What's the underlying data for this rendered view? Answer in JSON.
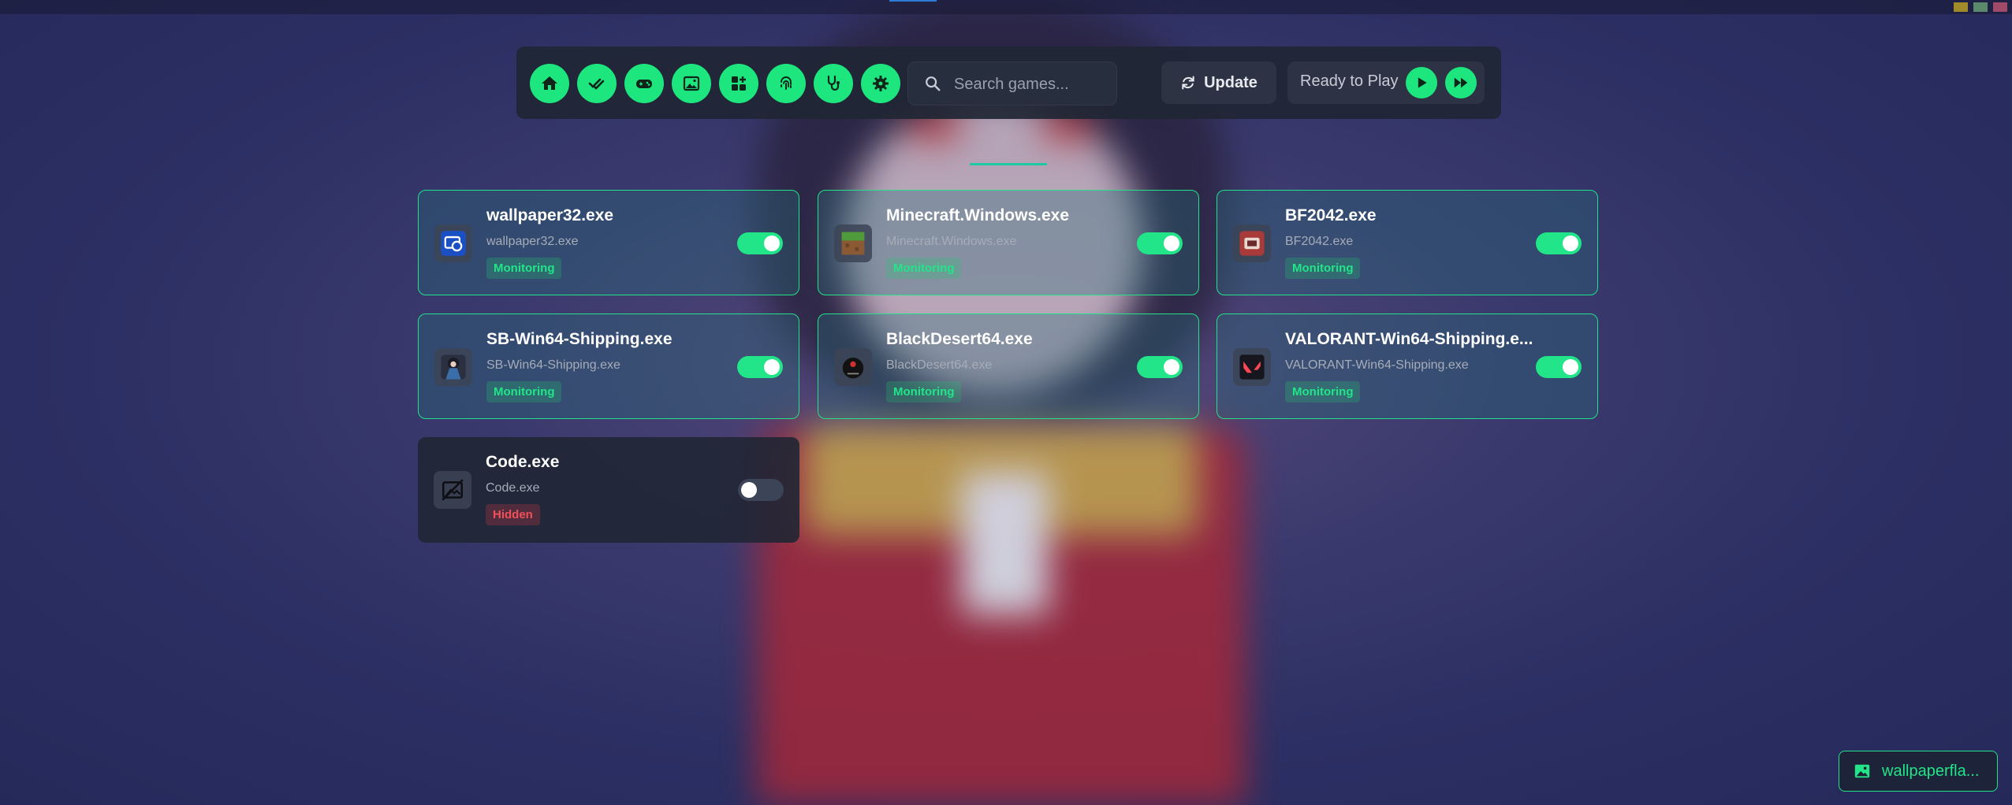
{
  "toolbar": {
    "nav_icons": [
      "home-icon",
      "checks-icon",
      "gamepad-icon",
      "image-icon",
      "apps-icon",
      "fingerprint-icon",
      "stethoscope-icon",
      "gear-icon"
    ],
    "search_placeholder": "Search games...",
    "update_label": "Update",
    "ready_label": "Ready to Play"
  },
  "colors": {
    "accent": "#1ee67f",
    "hidden": "#f0505a",
    "panel": "#202634"
  },
  "cards": [
    {
      "title": "wallpaper32.exe",
      "subtitle": "wallpaper32.exe",
      "status": "Monitoring",
      "enabled": true,
      "icon": "wallpaper-engine-icon"
    },
    {
      "title": "Minecraft.Windows.exe",
      "subtitle": "Minecraft.Windows.exe",
      "status": "Monitoring",
      "enabled": true,
      "icon": "minecraft-icon"
    },
    {
      "title": "BF2042.exe",
      "subtitle": "BF2042.exe",
      "status": "Monitoring",
      "enabled": true,
      "icon": "bf2042-icon"
    },
    {
      "title": "SB-Win64-Shipping.exe",
      "subtitle": "SB-Win64-Shipping.exe",
      "status": "Monitoring",
      "enabled": true,
      "icon": "stellar-blade-icon"
    },
    {
      "title": "BlackDesert64.exe",
      "subtitle": "BlackDesert64.exe",
      "status": "Monitoring",
      "enabled": true,
      "icon": "black-desert-icon"
    },
    {
      "title": "VALORANT-Win64-Shipping.e...",
      "subtitle": "VALORANT-Win64-Shipping.exe",
      "status": "Monitoring",
      "enabled": true,
      "icon": "valorant-icon"
    },
    {
      "title": "Code.exe",
      "subtitle": "Code.exe",
      "status": "Hidden",
      "enabled": false,
      "icon": "no-image-icon"
    }
  ],
  "wallpaper_button": {
    "label": "wallpaperfla..."
  }
}
